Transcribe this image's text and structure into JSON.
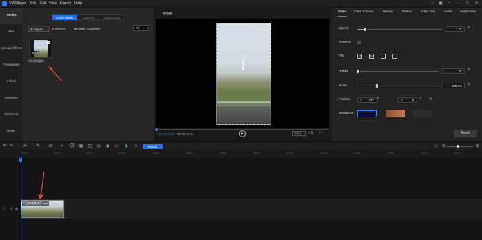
{
  "app": {
    "title": "VidClipper"
  },
  "menu": [
    "File",
    "Edit",
    "View",
    "Export",
    "Help"
  ],
  "window_icons": [
    "home-icon",
    "gift-icon",
    "user-icon",
    "minimize-icon",
    "maximize-icon",
    "close-icon"
  ],
  "leftnav": {
    "items": [
      "Media",
      "Text",
      "Special Effects",
      "Transitions",
      "Filters",
      "Overlays",
      "Elements",
      "Music"
    ],
    "active": "Media"
  },
  "media": {
    "tabs": [
      "Local Media",
      "Opening",
      "Background"
    ],
    "active_tab": "Local Media",
    "import_label": "Import",
    "record_label": "Record",
    "converter_label": "Video Converter",
    "filter_value": "All",
    "thumb_duration": "00:10",
    "thumb_name": "书生的视频文..."
  },
  "preview": {
    "title": "播放器",
    "current_time": "00:00:00.00",
    "total_time": "00:00:10.21",
    "zoom": "100",
    "progress_fraction": 0.0
  },
  "props": {
    "tabs": [
      "Video",
      "Color Correct",
      "Beauty",
      "Motion",
      "Color Key",
      "Audio",
      "KeyFrame"
    ],
    "active_tab": "Video",
    "speed_label": "Speed",
    "speed_value": "1.0x",
    "reverse_label": "Reverse",
    "flip_label": "Flip",
    "rotate_label": "Rotate",
    "rotate_value": "0°",
    "scale_label": "Scale",
    "scale_value": "100.0%",
    "position_label": "Position",
    "pos_x_label": "X",
    "pos_x": "237",
    "pos_y_label": "Y",
    "pos_y": "0",
    "background_label": "Backgrou...",
    "reset_label": "Reset",
    "speed_fraction": 0.08,
    "rotate_fraction": 0.0,
    "scale_fraction": 0.24,
    "swatch_colors": [
      "#0a1033",
      "#8a4a34",
      "#2c2c2c"
    ],
    "accent": "#2b7cff"
  },
  "timeline": {
    "export_label": "Export",
    "ruler": [
      "00:00",
      "00:10",
      "00:20",
      "00:30",
      "00:40",
      "00:50",
      "01:00",
      "01:10",
      "01:20",
      "01:30",
      "01:40",
      "01:50",
      "02:00",
      "02:10"
    ],
    "clip_label": "书生的视频文件.mp4"
  }
}
